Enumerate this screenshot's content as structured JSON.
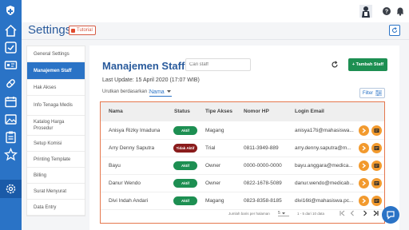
{
  "app": {
    "page_title": "Settings",
    "tutorial_label": "Tutorial"
  },
  "colors": {
    "primary": "#2a73c6",
    "success": "#1d8f52",
    "inactive": "#8a1c1c",
    "accent": "#f29a2e",
    "highlight": "#e5774d"
  },
  "rail": {
    "items": [
      "home-icon",
      "checkbox-icon",
      "id-card-icon",
      "pill-icon",
      "calendar-icon",
      "image-icon",
      "clipboard-icon",
      "star-icon",
      "gear-icon"
    ]
  },
  "topbar": {
    "icons": [
      "user-avatar",
      "help-icon",
      "bell-icon",
      "settings-icon"
    ]
  },
  "menu": {
    "items": [
      {
        "label": "General Settings"
      },
      {
        "label": "Manajemen Staff"
      },
      {
        "label": "Hak Akses"
      },
      {
        "label": "Info Tenaga Medis"
      },
      {
        "label": "Katalog Harga Prosedur"
      },
      {
        "label": "Setup Komisi"
      },
      {
        "label": "Printing Template"
      },
      {
        "label": "Billing"
      },
      {
        "label": "Surat Menyurat"
      },
      {
        "label": "Data Entry"
      }
    ]
  },
  "main": {
    "title": "Manajemen Staff",
    "search_placeholder": "Cari staff",
    "add_button": "+ Tambah Staff",
    "last_update": "Last Update: 15 April 2020 (17:07 WIB)",
    "sort_label": "Urutkan berdasarkan :",
    "sort_value": "Nama",
    "filter_label": "Filter"
  },
  "table": {
    "columns": [
      "Nama",
      "Status",
      "Tipe Akses",
      "Nomor HP",
      "Login Email"
    ],
    "rows": [
      {
        "name": "Anisya Rizky Imaduna",
        "status": "Aktif",
        "access": "Magang",
        "phone": "",
        "email": "anisya17ti@mahasiswa..."
      },
      {
        "name": "Arry Denny Saputra",
        "status": "Tidak Aktif",
        "access": "Trial",
        "phone": "0811-3949-889",
        "email": "arry.denny.saputra@m..."
      },
      {
        "name": "Bayu",
        "status": "Aktif",
        "access": "Owner",
        "phone": "0000-0000-0000",
        "email": "bayu.anggara@medica..."
      },
      {
        "name": "Danur Wendo",
        "status": "Aktif",
        "access": "Owner",
        "phone": "0822-1678-5089",
        "email": "danur.wendo@medicab..."
      },
      {
        "name": "Divi Indah Andari",
        "status": "Aktif",
        "access": "Magang",
        "phone": "0823-8358-8185",
        "email": "divi16ti@mahasiswa.pc..."
      }
    ]
  },
  "pager": {
    "rows_label": "Jumlah baris per halaman",
    "rows_value": "5",
    "range": "1 - 5 dari 10 data"
  }
}
